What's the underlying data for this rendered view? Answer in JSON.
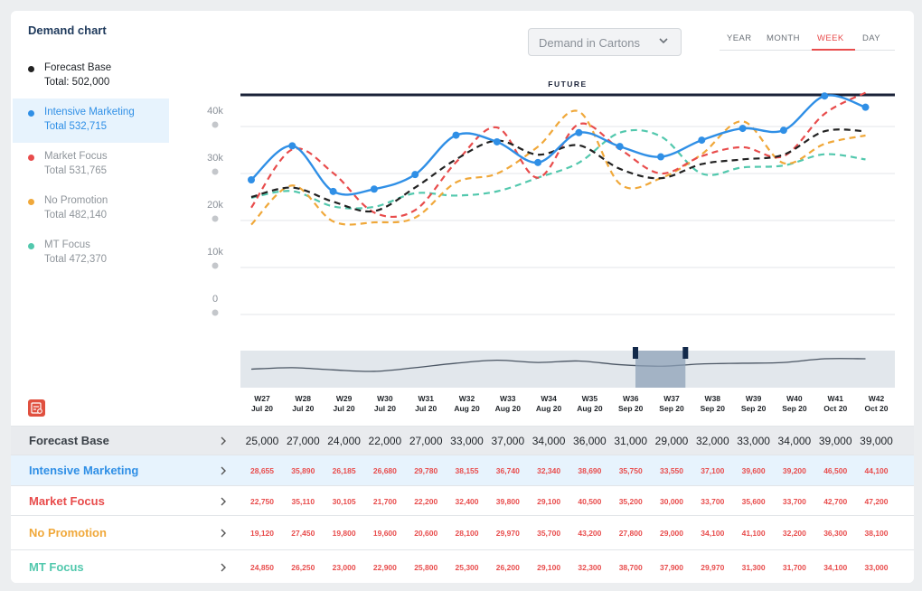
{
  "header": {
    "title": "Demand chart"
  },
  "legend": [
    {
      "name": "Forecast Base",
      "total": "Total: 502,000",
      "color": "#222222",
      "text_color": "#1f2328",
      "active": false
    },
    {
      "name": "Intensive Marketing",
      "total": "Total 532,715",
      "color": "#2f8fe6",
      "text_color": "#2f8fe6",
      "active": true
    },
    {
      "name": "Market Focus",
      "total": "Total 531,765",
      "color": "#e84c4c",
      "text_color": "#8f959b",
      "active": false
    },
    {
      "name": "No Promotion",
      "total": "Total 482,140",
      "color": "#f0a83a",
      "text_color": "#8f959b",
      "active": false
    },
    {
      "name": "MT Focus",
      "total": "Total 472,370",
      "color": "#52c8ad",
      "text_color": "#8f959b",
      "active": false
    }
  ],
  "measure_select": {
    "value": "Demand in Cartons"
  },
  "time_tabs": [
    {
      "label": "YEAR",
      "active": false
    },
    {
      "label": "MONTH",
      "active": false
    },
    {
      "label": "WEEK",
      "active": true
    },
    {
      "label": "DAY",
      "active": false
    }
  ],
  "future_label": "FUTURE",
  "chart_data": {
    "type": "line",
    "x": [
      "W27 Jul 20",
      "W28 Jul 20",
      "W29 Jul 20",
      "W30 Jul 20",
      "W31 Jul 20",
      "W32 Aug 20",
      "W33 Aug 20",
      "W34 Aug 20",
      "W35 Aug 20",
      "W36 Sep 20",
      "W37 Sep 20",
      "W38 Sep 20",
      "W39 Sep 20",
      "W40 Sep 20",
      "W41 Oct 20",
      "W42 Oct 20"
    ],
    "x_week": [
      "W27",
      "W28",
      "W29",
      "W30",
      "W31",
      "W32",
      "W33",
      "W34",
      "W35",
      "W36",
      "W37",
      "W38",
      "W39",
      "W40",
      "W41",
      "W42"
    ],
    "x_month": [
      "Jul 20",
      "Jul 20",
      "Jul 20",
      "Jul 20",
      "Jul 20",
      "Aug 20",
      "Aug 20",
      "Aug 20",
      "Aug 20",
      "Sep 20",
      "Sep 20",
      "Sep 20",
      "Sep 20",
      "Sep 20",
      "Oct 20",
      "Oct 20"
    ],
    "yticks": [
      "40k",
      "30k",
      "20k",
      "10k",
      "0"
    ],
    "ylim": [
      0,
      40000
    ],
    "grid": true,
    "series": [
      {
        "name": "Forecast Base",
        "color": "#222222",
        "dash": true,
        "markers": false,
        "values": [
          25000,
          27000,
          24000,
          22000,
          27000,
          33000,
          37000,
          34000,
          36000,
          31000,
          29000,
          32000,
          33000,
          34000,
          39000,
          39000
        ]
      },
      {
        "name": "Intensive Marketing",
        "color": "#2f8fe6",
        "dash": false,
        "markers": true,
        "values": [
          28655,
          35890,
          26185,
          26680,
          29780,
          38155,
          36740,
          32340,
          38690,
          35750,
          33550,
          37100,
          39600,
          39200,
          46500,
          44100
        ]
      },
      {
        "name": "Market Focus",
        "color": "#e84c4c",
        "dash": true,
        "markers": false,
        "values": [
          22750,
          35110,
          30105,
          21700,
          22200,
          32400,
          39800,
          29100,
          40500,
          35200,
          30000,
          33700,
          35600,
          33700,
          42700,
          47200
        ]
      },
      {
        "name": "No Promotion",
        "color": "#f0a83a",
        "dash": true,
        "markers": false,
        "values": [
          19120,
          27450,
          19800,
          19600,
          20600,
          28100,
          29970,
          35700,
          43200,
          27800,
          29000,
          34100,
          41100,
          32200,
          36300,
          38100
        ]
      },
      {
        "name": "MT Focus",
        "color": "#52c8ad",
        "dash": true,
        "markers": false,
        "values": [
          24850,
          26250,
          23000,
          22900,
          25800,
          25300,
          26200,
          29100,
          32300,
          38700,
          37900,
          29970,
          31300,
          31700,
          34100,
          33000
        ]
      }
    ],
    "range_selector": {
      "start_index": 10,
      "end_index": 11
    }
  },
  "table": {
    "rows": [
      {
        "name": "Forecast Base",
        "name_color": "#3b4148",
        "value_color": "#1f2328",
        "bg": "#e9ebee",
        "values": [
          "25,000",
          "27,000",
          "24,000",
          "22,000",
          "27,000",
          "33,000",
          "37,000",
          "34,000",
          "36,000",
          "31,000",
          "29,000",
          "32,000",
          "33,000",
          "34,000",
          "39,000",
          "39,000"
        ]
      },
      {
        "name": "Intensive Marketing",
        "name_color": "#2f8fe6",
        "value_color": "#e84c4c",
        "bg": "#e7f3fd",
        "values": [
          "28,655",
          "35,890",
          "26,185",
          "26,680",
          "29,780",
          "38,155",
          "36,740",
          "32,340",
          "38,690",
          "35,750",
          "33,550",
          "37,100",
          "39,600",
          "39,200",
          "46,500",
          "44,100"
        ]
      },
      {
        "name": "Market Focus",
        "name_color": "#e84c4c",
        "value_color": "#e84c4c",
        "bg": "#ffffff",
        "values": [
          "22,750",
          "35,110",
          "30,105",
          "21,700",
          "22,200",
          "32,400",
          "39,800",
          "29,100",
          "40,500",
          "35,200",
          "30,000",
          "33,700",
          "35,600",
          "33,700",
          "42,700",
          "47,200"
        ]
      },
      {
        "name": "No Promotion",
        "name_color": "#f0a83a",
        "value_color": "#e84c4c",
        "bg": "#ffffff",
        "values": [
          "19,120",
          "27,450",
          "19,800",
          "19,600",
          "20,600",
          "28,100",
          "29,970",
          "35,700",
          "43,200",
          "27,800",
          "29,000",
          "34,100",
          "41,100",
          "32,200",
          "36,300",
          "38,100"
        ]
      },
      {
        "name": "MT Focus",
        "name_color": "#52c8ad",
        "value_color": "#e84c4c",
        "bg": "#ffffff",
        "values": [
          "24,850",
          "26,250",
          "23,000",
          "22,900",
          "25,800",
          "25,300",
          "26,200",
          "29,100",
          "32,300",
          "38,700",
          "37,900",
          "29,970",
          "31,300",
          "31,700",
          "34,100",
          "33,000"
        ]
      }
    ]
  }
}
